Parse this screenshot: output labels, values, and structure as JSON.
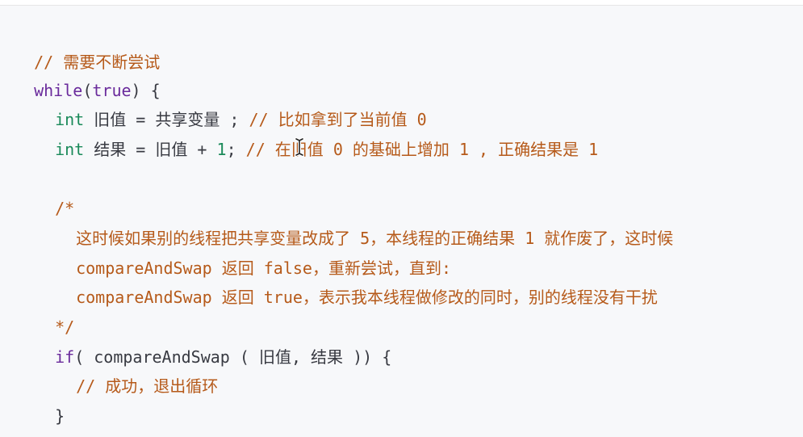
{
  "code": {
    "line1": {
      "comment": "// 需要不断尝试"
    },
    "line2": {
      "keyword": "while",
      "open": "(",
      "cond": "true",
      "rest": ") {"
    },
    "line3": {
      "type": "int",
      "stmt": " 旧值 = 共享变量 ; ",
      "comment": "// 比如拿到了当前值 0"
    },
    "line4": {
      "type": "int",
      "stmt_a": " 结果 = 旧值 + ",
      "num": "1",
      "stmt_b": "; ",
      "comment": "// 在旧值 0 的基础上增加 1 , 正确结果是 1"
    },
    "line5": {
      "comment": "/*"
    },
    "line6": {
      "comment": "这时候如果别的线程把共享变量改成了 5，本线程的正确结果 1 就作废了，这时候"
    },
    "line7": {
      "comment": "compareAndSwap 返回 false，重新尝试，直到:"
    },
    "line8": {
      "comment": "compareAndSwap 返回 true，表示我本线程做修改的同时，别的线程没有干扰"
    },
    "line9": {
      "comment": "*/"
    },
    "line10": {
      "keyword": "if",
      "rest": "( compareAndSwap ( 旧值, 结果 )) {"
    },
    "line11": {
      "comment": "// 成功，退出循环"
    },
    "line12": {
      "text": "}"
    },
    "line13": {
      "text": "}"
    }
  },
  "colors": {
    "comment": "#b65a1a",
    "keyword": "#6a2b9c",
    "type": "#1b8a5a",
    "plain": "#383a42",
    "background": "#f7f8fa"
  },
  "cursor_icon": "text-cursor-icon"
}
